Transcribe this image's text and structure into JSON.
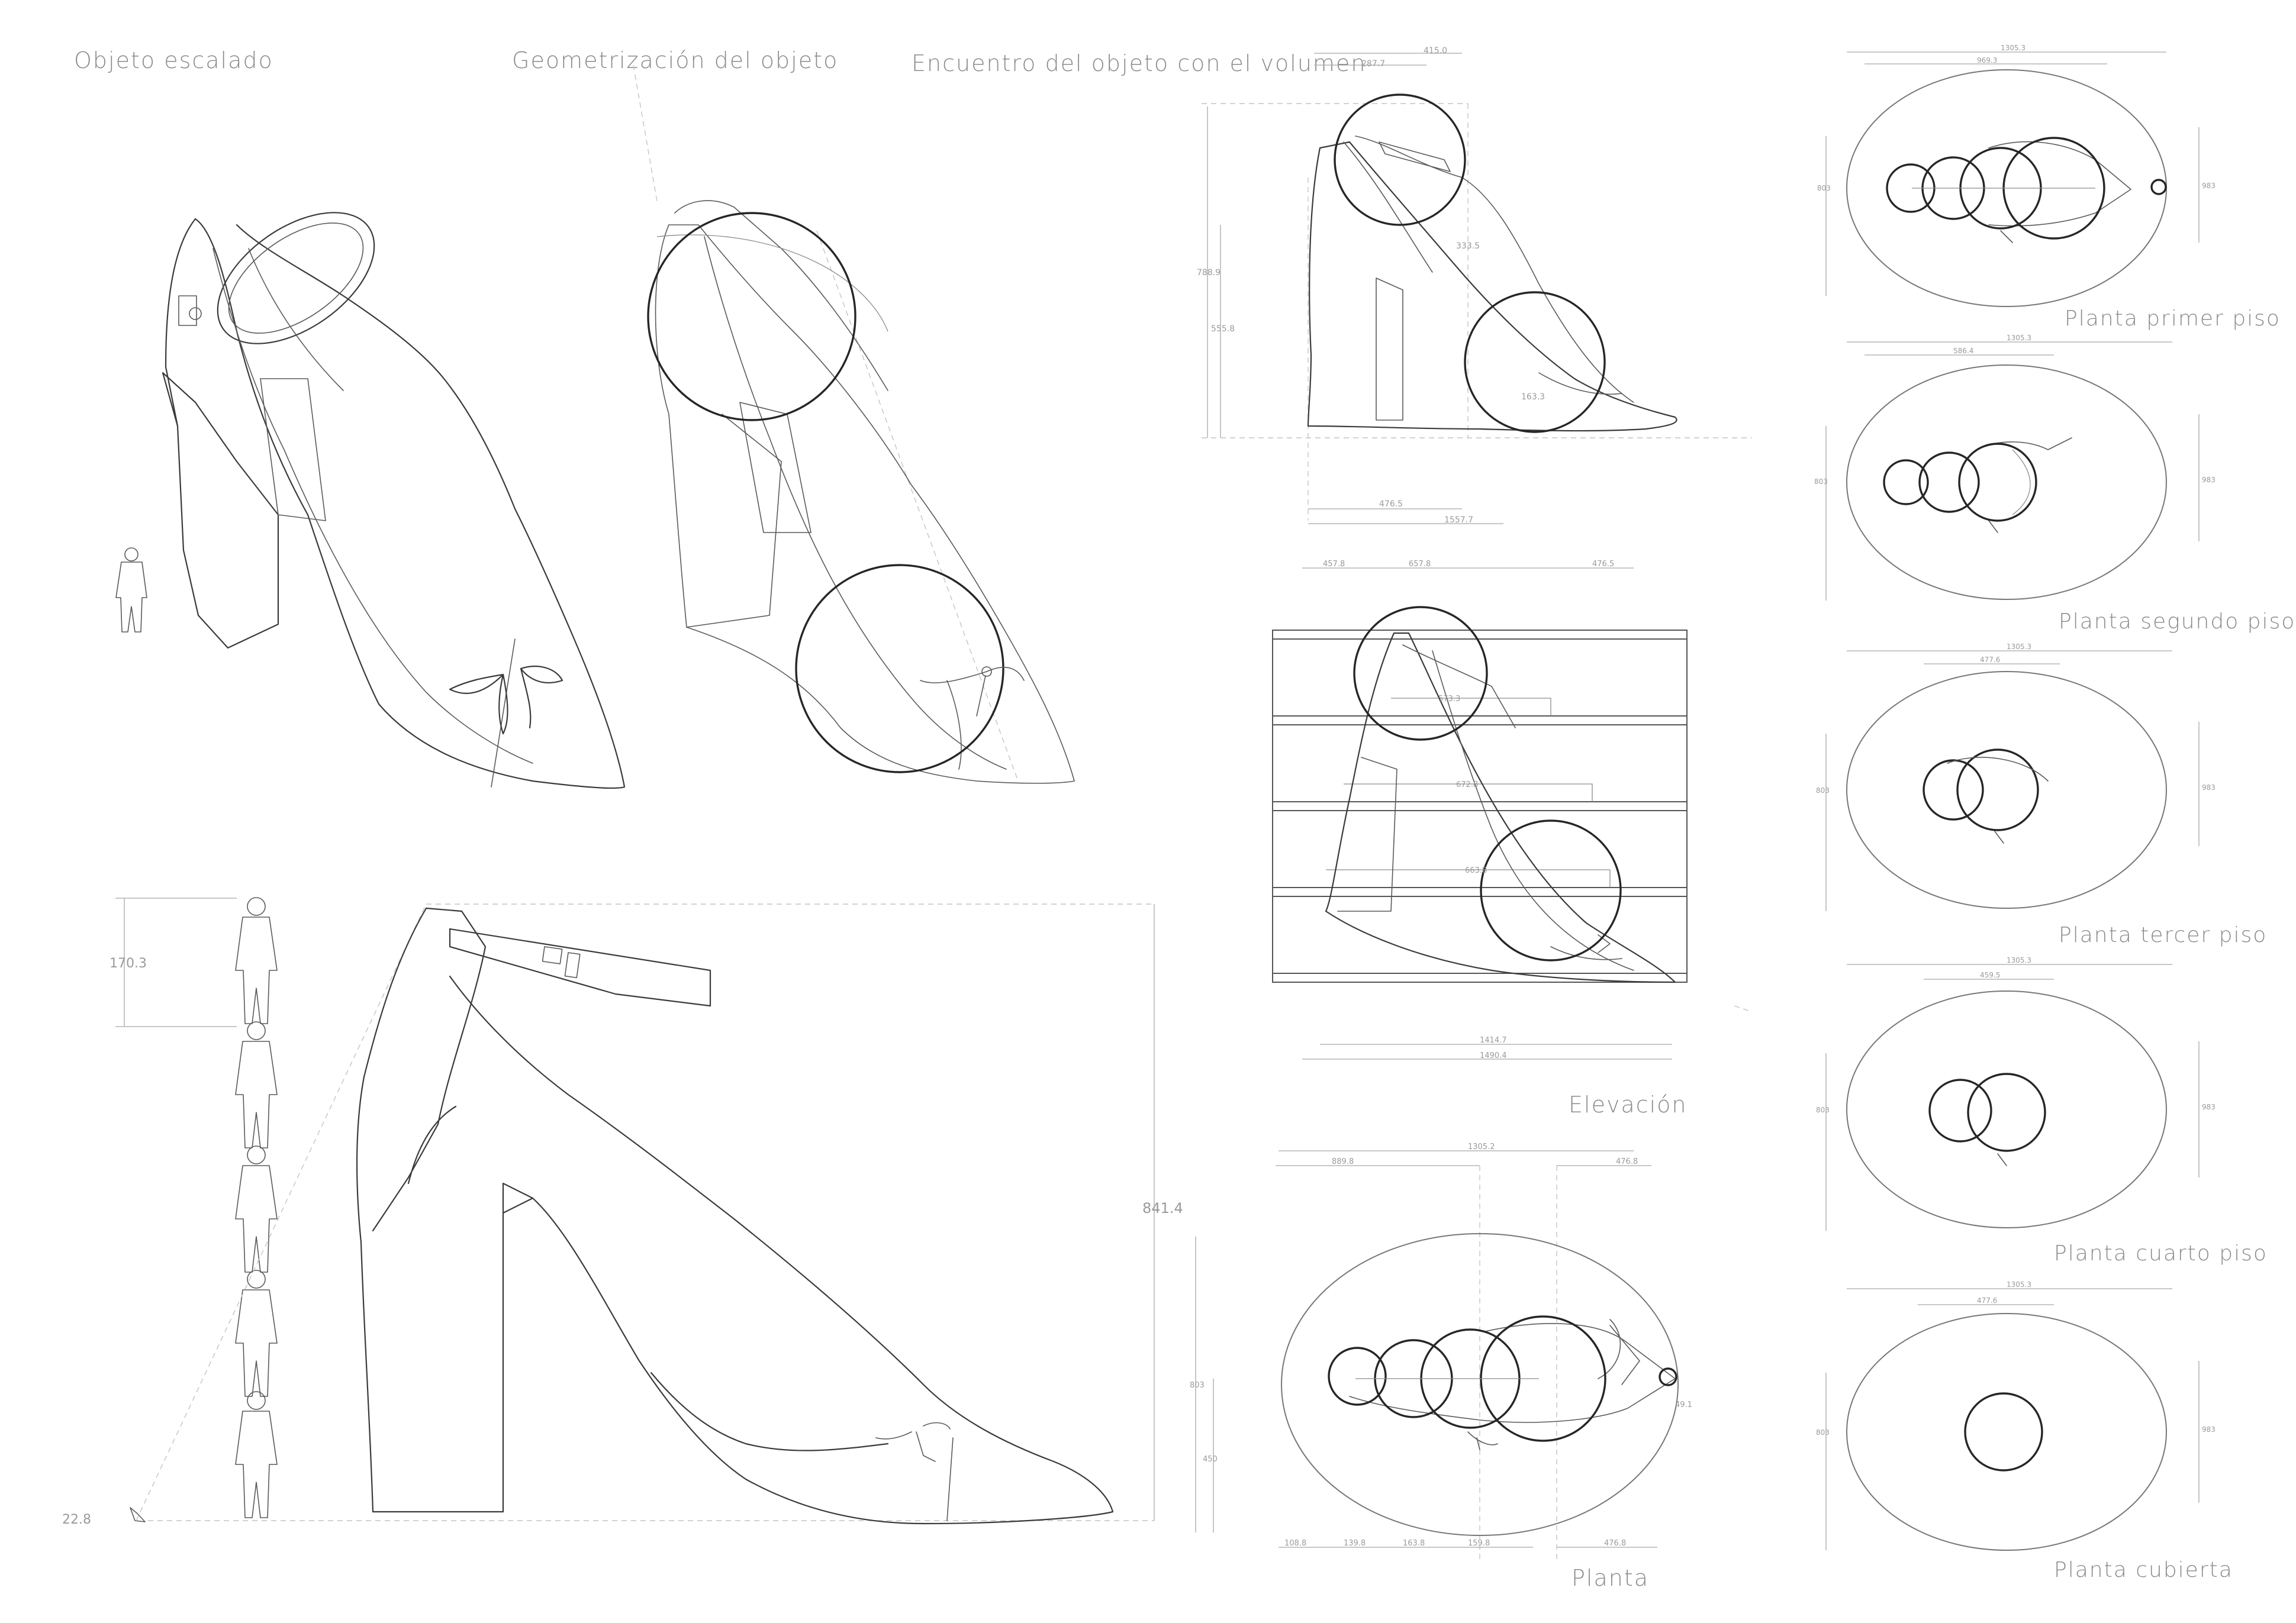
{
  "titles": {
    "scaled": "Objeto escalado",
    "geometrization": "Geometrización del objeto",
    "encounter": "Encuentro del objeto con el volumen"
  },
  "labels": {
    "elevacion": "Elevación",
    "planta": "Planta",
    "planta_primer": "Planta primer piso",
    "planta_segundo": "Planta segundo piso",
    "planta_tercer": "Planta tercer piso",
    "planta_cuarto": "Planta cuarto piso",
    "planta_cubierta": "Planta cubierta"
  },
  "dimensions": {
    "human_height": "170.3",
    "object_small": "22.8",
    "object_large": "841.4"
  },
  "colors": {
    "line": "#3a3a3a",
    "circle": "#262626",
    "label": "#8a8a8a",
    "dashed": "#c4c4c4"
  }
}
